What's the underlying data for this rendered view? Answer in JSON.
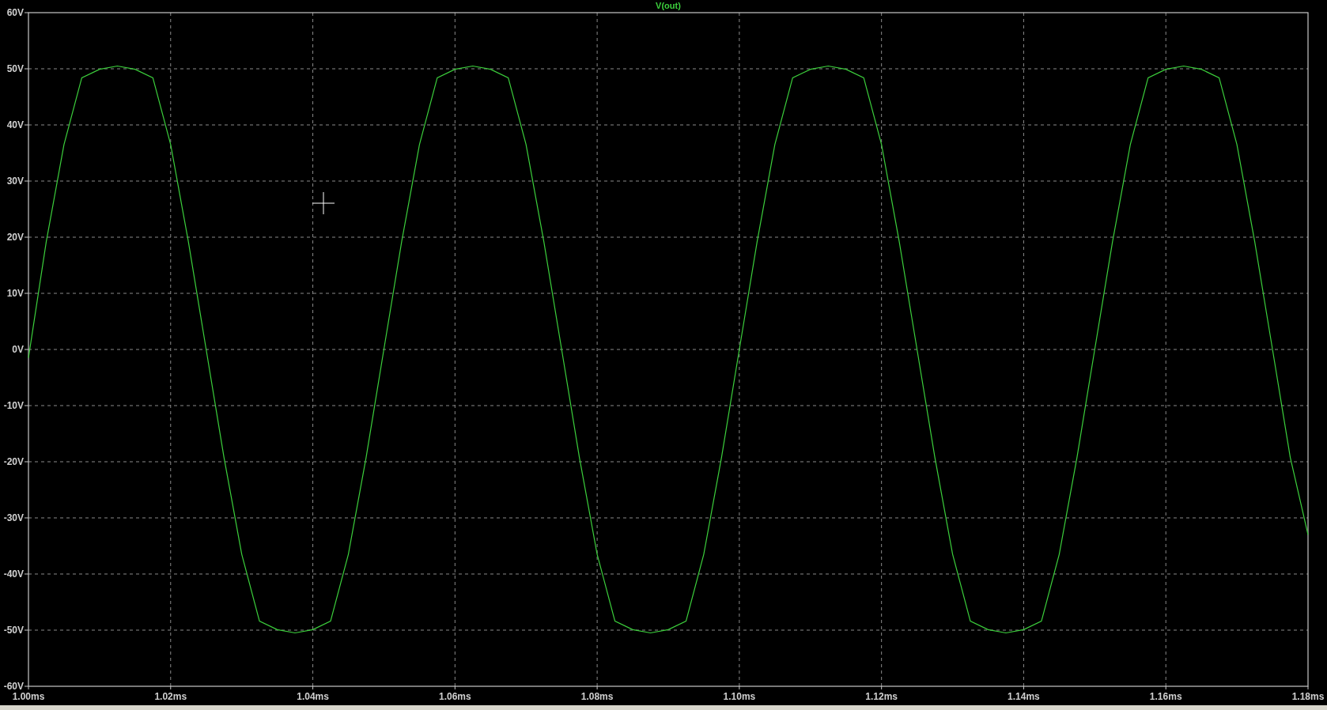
{
  "plot": {
    "chart_data": {
      "type": "line",
      "grid": true,
      "x": [
        1.0,
        1.0025,
        1.005,
        1.0075,
        1.01,
        1.0125,
        1.015,
        1.0175,
        1.02,
        1.0225,
        1.025,
        1.0275,
        1.03,
        1.0325,
        1.035,
        1.0375,
        1.04,
        1.0425,
        1.045,
        1.0475,
        1.05,
        1.0525,
        1.055,
        1.0575,
        1.06,
        1.0625,
        1.065,
        1.0675,
        1.07,
        1.0725,
        1.075,
        1.0775,
        1.08,
        1.0825,
        1.085,
        1.0875,
        1.09,
        1.0925,
        1.095,
        1.0975,
        1.1,
        1.1025,
        1.105,
        1.1075,
        1.11,
        1.1125,
        1.115,
        1.1175,
        1.12,
        1.1225,
        1.125,
        1.1275,
        1.13,
        1.1325,
        1.135,
        1.1375,
        1.14,
        1.1425,
        1.145,
        1.1475,
        1.15,
        1.1525,
        1.155,
        1.1575,
        1.16,
        1.1625,
        1.165,
        1.1675,
        1.17,
        1.1725,
        1.175,
        1.1775,
        1.18
      ],
      "series": [
        {
          "name": "V(out)",
          "color": "#3ccf3c",
          "values": [
            -1.5,
            19.2,
            36.5,
            48.4,
            49.9,
            50.5,
            49.9,
            48.4,
            36.5,
            19.2,
            0,
            -19.2,
            -36.5,
            -48.4,
            -49.9,
            -50.5,
            -49.9,
            -48.4,
            -36.5,
            -19.2,
            0,
            19.2,
            36.5,
            48.4,
            49.9,
            50.5,
            49.9,
            48.4,
            36.5,
            19.2,
            0,
            -19.2,
            -36.5,
            -48.4,
            -49.9,
            -50.5,
            -49.9,
            -48.4,
            -36.5,
            -19.2,
            0,
            19.2,
            36.5,
            48.4,
            49.9,
            50.5,
            49.9,
            48.4,
            36.5,
            19.2,
            0,
            -19.2,
            -36.5,
            -48.4,
            -49.9,
            -50.5,
            -49.9,
            -48.4,
            -36.5,
            -19.2,
            0,
            19.2,
            36.5,
            48.4,
            49.9,
            50.5,
            49.9,
            48.4,
            36.5,
            19.2,
            0,
            -19.2,
            -33
          ]
        }
      ],
      "xlim": [
        1.0,
        1.18
      ],
      "ylim": [
        -60,
        60
      ],
      "xticks": [
        {
          "value": 1.0,
          "label": "1.00ms"
        },
        {
          "value": 1.02,
          "label": "1.02ms"
        },
        {
          "value": 1.04,
          "label": "1.04ms"
        },
        {
          "value": 1.06,
          "label": "1.06ms"
        },
        {
          "value": 1.08,
          "label": "1.08ms"
        },
        {
          "value": 1.1,
          "label": "1.10ms"
        },
        {
          "value": 1.12,
          "label": "1.12ms"
        },
        {
          "value": 1.14,
          "label": "1.14ms"
        },
        {
          "value": 1.16,
          "label": "1.16ms"
        },
        {
          "value": 1.18,
          "label": "1.18ms"
        }
      ],
      "yticks": [
        {
          "value": 60,
          "label": "60V"
        },
        {
          "value": 50,
          "label": "50V"
        },
        {
          "value": 40,
          "label": "40V"
        },
        {
          "value": 30,
          "label": "30V"
        },
        {
          "value": 20,
          "label": "20V"
        },
        {
          "value": 10,
          "label": "10V"
        },
        {
          "value": 0,
          "label": "0V"
        },
        {
          "value": -10,
          "label": "-10V"
        },
        {
          "value": -20,
          "label": "-20V"
        },
        {
          "value": -30,
          "label": "-30V"
        },
        {
          "value": -40,
          "label": "-40V"
        },
        {
          "value": -50,
          "label": "-50V"
        },
        {
          "value": -60,
          "label": "-60V"
        }
      ]
    }
  }
}
